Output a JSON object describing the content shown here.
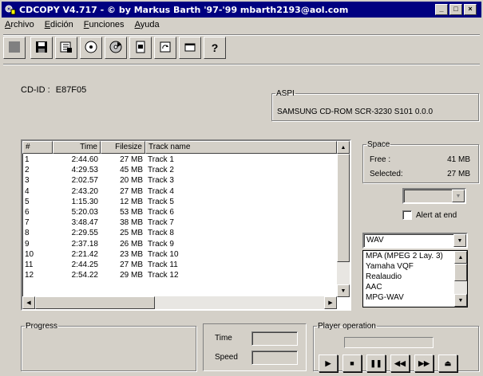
{
  "window": {
    "title": "CDCOPY  V4.717  - © by Markus Barth '97-'99 mbarth2193@aol.com",
    "controls": [
      "minimize",
      "maximize",
      "close"
    ]
  },
  "menu": [
    "Archivo",
    "Edición",
    "Funciones",
    "Ayuda"
  ],
  "toolbar": [
    "stop-icon",
    "save-icon",
    "copy-icon",
    "cd-icon",
    "cd-play-icon",
    "document-icon",
    "refresh-icon",
    "window-icon",
    "help-icon"
  ],
  "cd_id": {
    "label": "CD-ID :",
    "value": "E87F05"
  },
  "aspi": {
    "legend": "ASPI",
    "device": "SAMSUNG CD-ROM SCR-3230 S101 0.0.0"
  },
  "space": {
    "legend": "Space",
    "free_label": "Free :",
    "free_value": "41 MB",
    "selected_label": "Selected:",
    "selected_value": "27 MB"
  },
  "tracks": {
    "columns": [
      "#",
      "Time",
      "Filesize",
      "Track name"
    ],
    "rows": [
      [
        "1",
        "2:44.60",
        "27 MB",
        "Track  1"
      ],
      [
        "2",
        "4:29.53",
        "45 MB",
        "Track  2"
      ],
      [
        "3",
        "2:02.57",
        "20 MB",
        "Track  3"
      ],
      [
        "4",
        "2:43.20",
        "27 MB",
        "Track  4"
      ],
      [
        "5",
        "1:15.30",
        "12 MB",
        "Track  5"
      ],
      [
        "6",
        "5:20.03",
        "53 MB",
        "Track  6"
      ],
      [
        "7",
        "3:48.47",
        "38 MB",
        "Track  7"
      ],
      [
        "8",
        "2:29.55",
        "25 MB",
        "Track  8"
      ],
      [
        "9",
        "2:37.18",
        "26 MB",
        "Track  9"
      ],
      [
        "10",
        "2:21.42",
        "23 MB",
        "Track 10"
      ],
      [
        "11",
        "2:44.25",
        "27 MB",
        "Track 11"
      ],
      [
        "12",
        "2:54.22",
        "29 MB",
        "Track 12"
      ]
    ]
  },
  "drive_select": {
    "value": ""
  },
  "alert_at_end": {
    "label": "Alert at end",
    "checked": false
  },
  "format": {
    "selected": "WAV",
    "options": [
      "MPA (MPEG 2 Lay. 3)",
      "Yamaha VQF",
      "Realaudio",
      "AAC",
      "MPG-WAV"
    ]
  },
  "progress": {
    "legend": "Progress"
  },
  "time_speed": {
    "time_label": "Time",
    "speed_label": "Speed"
  },
  "player": {
    "legend": "Player operation",
    "buttons": [
      "play-icon",
      "stop-icon",
      "pause-icon",
      "previous-icon",
      "next-icon",
      "eject-icon"
    ]
  }
}
